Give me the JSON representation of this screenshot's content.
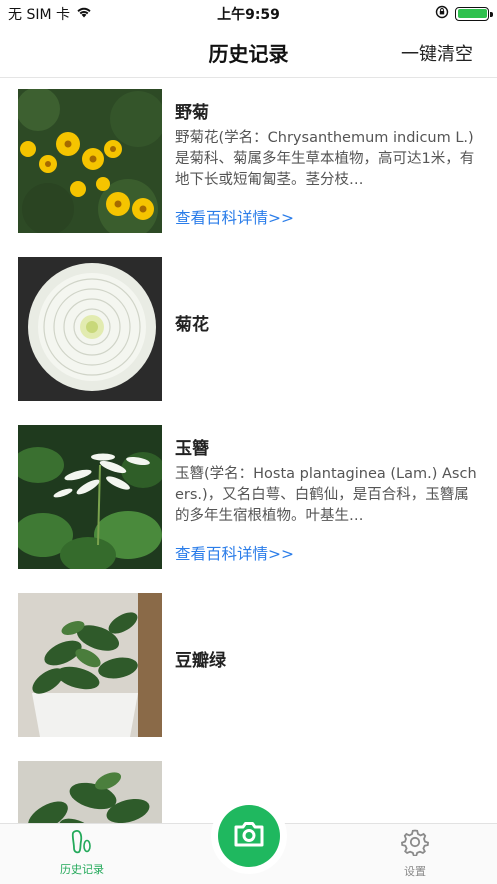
{
  "status_bar": {
    "carrier": "无 SIM 卡",
    "time": "上午9:59",
    "battery_level": 1.0
  },
  "nav": {
    "title": "历史记录",
    "clear_all": "一键清空"
  },
  "history": [
    {
      "name": "野菊",
      "description": "野菊花(学名：Chrysanthemum indicum L.)是菊科、菊属多年生草本植物，高可达1米，有地下长或短匍匐茎。茎分枝…",
      "link": "查看百科详情>>",
      "image": "chrysanthemum-indicum-photo"
    },
    {
      "name": "菊花",
      "description": "",
      "link": "",
      "image": "white-chrysanthemum-photo"
    },
    {
      "name": "玉簪",
      "description": "玉簪(学名：Hosta plantaginea (Lam.) Aschers.)，又名白萼、白鹤仙，是百合科，玉簪属的多年生宿根植物。叶基生…",
      "link": "查看百科详情>>",
      "image": "hosta-photo"
    },
    {
      "name": "豆瓣绿",
      "description": "",
      "link": "",
      "image": "peperomia-potted-photo"
    },
    {
      "name": "",
      "description": "",
      "link": "",
      "image": "green-plant-photo"
    }
  ],
  "tabs": {
    "history_label": "历史记录",
    "settings_label": "设置"
  },
  "colors": {
    "accent_green": "#1fb85f",
    "link_blue": "#2b7de9"
  },
  "icons": [
    "wifi-icon",
    "lock-rotation-icon",
    "battery-icon",
    "footprint-icon",
    "camera-icon",
    "gear-icon"
  ]
}
